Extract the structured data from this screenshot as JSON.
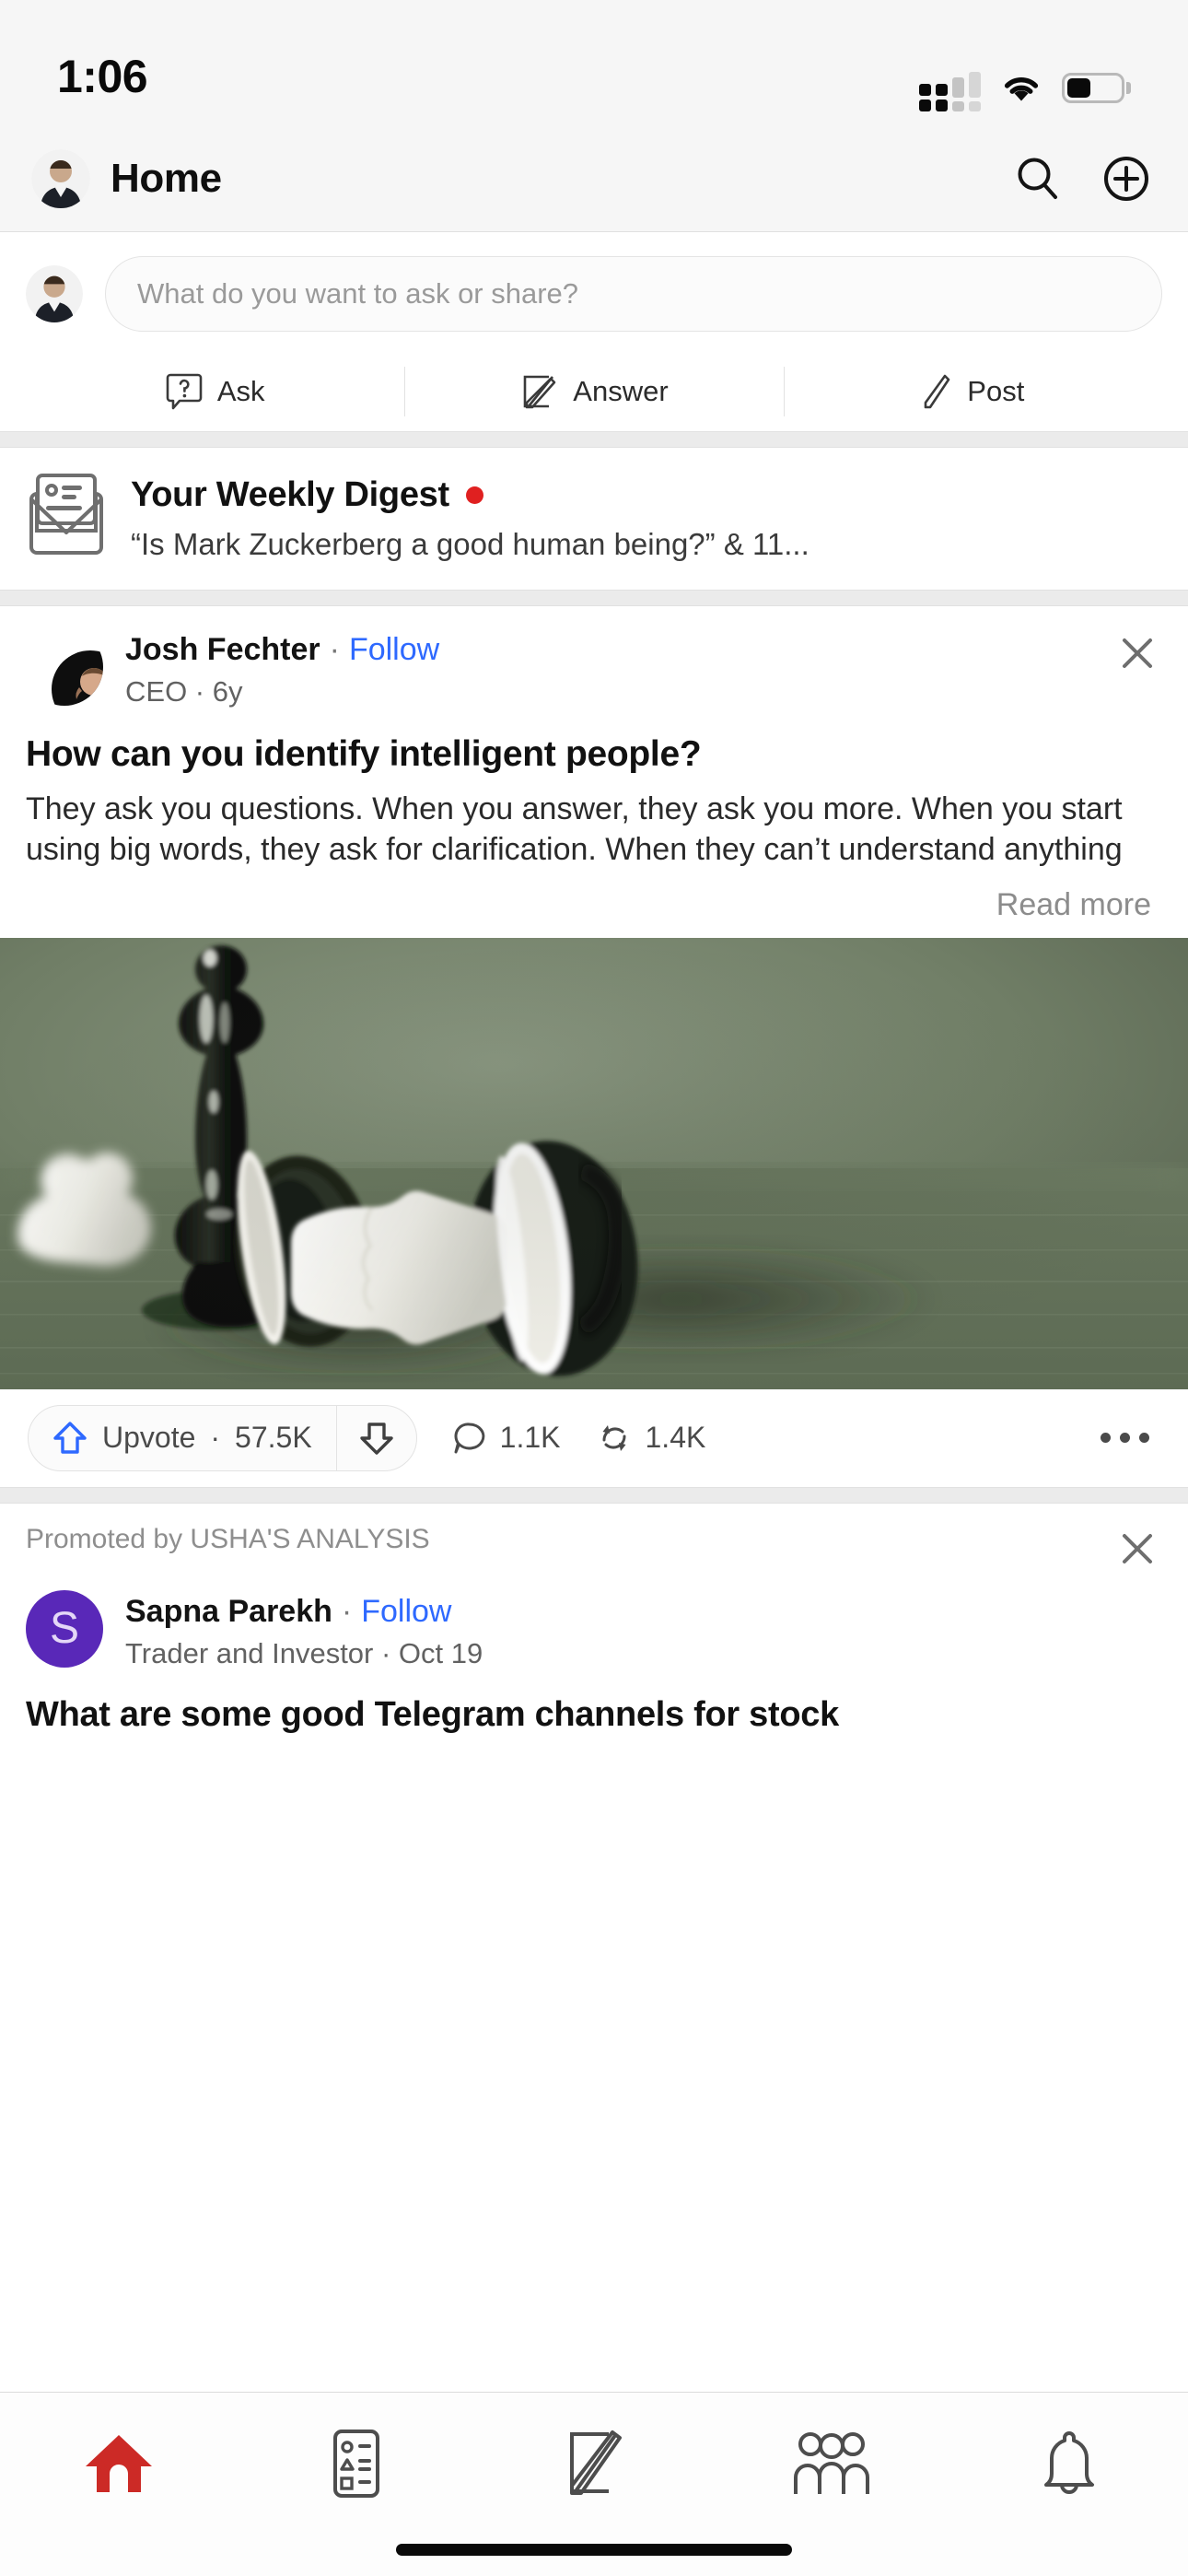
{
  "status_bar": {
    "time": "1:06",
    "cellular_icon": "cellular-signal-icon",
    "wifi_icon": "wifi-icon",
    "battery_icon": "battery-icon",
    "battery_level_percent": 45
  },
  "header": {
    "title": "Home",
    "avatar_icon": "user-avatar",
    "search_icon": "search-icon",
    "add_icon": "plus-circle-icon"
  },
  "composer": {
    "placeholder": "What do you want to ask or share?",
    "avatar_icon": "user-avatar",
    "actions": [
      {
        "label": "Ask",
        "icon": "question-bubble-icon"
      },
      {
        "label": "Answer",
        "icon": "pencil-square-icon"
      },
      {
        "label": "Post",
        "icon": "pencil-icon"
      }
    ]
  },
  "digest": {
    "icon": "newsletter-envelope-icon",
    "title": "Your Weekly Digest",
    "unread_dot_color": "#e02020",
    "subtitle": "“Is Mark Zuckerberg a good human being?” & 11..."
  },
  "post": {
    "author": "Josh Fechter",
    "name_separator": "·",
    "follow_label": "Follow",
    "credential": "CEO",
    "timestamp": "6y",
    "subline": "CEO · 6y",
    "close_icon": "close-icon",
    "title": "How can you identify intelligent people?",
    "body": "They ask you questions. When you answer, they ask you more. When you start using big words, they ask for clarification. When they can’t understand anything",
    "read_more_label": "Read more",
    "image_alt": "black chess queen standing over fallen white chess pieces on green felt"
  },
  "post_actions": {
    "upvote_icon": "upvote-arrow-icon",
    "upvote_label": "Upvote",
    "upvote_separator": "·",
    "upvote_count": "57.5K",
    "downvote_icon": "downvote-arrow-icon",
    "comment_icon": "comment-bubble-icon",
    "comment_count": "1.1K",
    "repost_icon": "repost-icon",
    "repost_count": "1.4K",
    "more_icon": "more-horizontal-icon",
    "upvote_accent_color": "#2e69ff"
  },
  "promoted_post": {
    "promoted_label": "Promoted by USHA'S ANALYSIS",
    "close_icon": "close-icon",
    "avatar_initial": "S",
    "avatar_color": "#5928b8",
    "author": "Sapna Parekh",
    "name_separator": "·",
    "follow_label": "Follow",
    "subline": "Trader and Investor · Oct 19",
    "title": "What are some good Telegram channels for stock"
  },
  "tab_bar": {
    "active_color": "#cc2a26",
    "inactive_color": "#4d4d4d",
    "tabs": [
      {
        "name": "home",
        "icon": "home-icon",
        "active": true
      },
      {
        "name": "following",
        "icon": "feed-list-icon",
        "active": false
      },
      {
        "name": "answer",
        "icon": "pencil-square-icon",
        "active": false
      },
      {
        "name": "spaces",
        "icon": "people-group-icon",
        "active": false
      },
      {
        "name": "notifications",
        "icon": "bell-icon",
        "active": false
      }
    ]
  }
}
